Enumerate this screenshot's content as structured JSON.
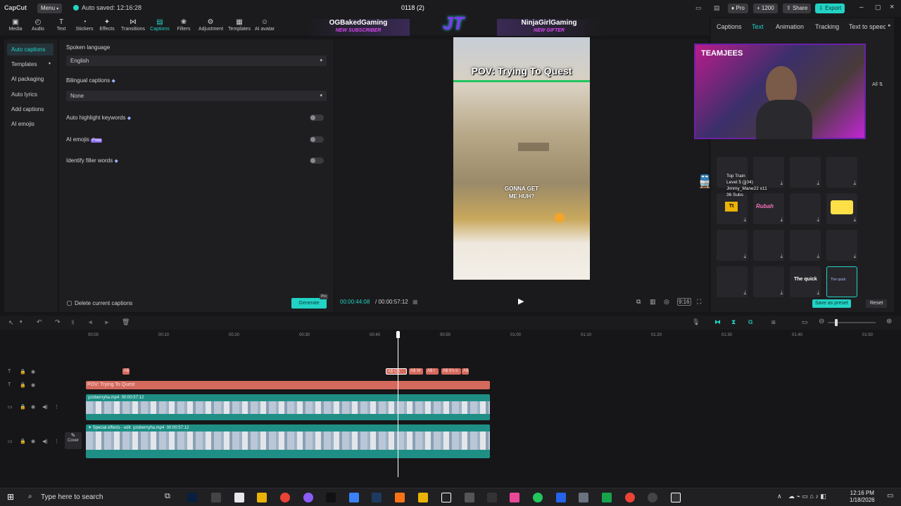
{
  "titlebar": {
    "app_name": "CapCut",
    "menu_label": "Menu",
    "autosave": "Auto saved: 12:16:28",
    "project_name": "0118 (2)",
    "pro_label": "Pro",
    "credits": "1200",
    "share_label": "Share",
    "export_label": "Export"
  },
  "toolbar": {
    "items": [
      {
        "label": "Media",
        "icon": "media-icon"
      },
      {
        "label": "Audio",
        "icon": "audio-icon"
      },
      {
        "label": "Text",
        "icon": "text-icon"
      },
      {
        "label": "Stickers",
        "icon": "stickers-icon"
      },
      {
        "label": "Effects",
        "icon": "effects-icon"
      },
      {
        "label": "Transitions",
        "icon": "transitions-icon"
      },
      {
        "label": "Captions",
        "icon": "captions-icon"
      },
      {
        "label": "Filters",
        "icon": "filters-icon"
      },
      {
        "label": "Adjustment",
        "icon": "adjustment-icon"
      },
      {
        "label": "Templates",
        "icon": "templates-icon"
      },
      {
        "label": "AI avatar",
        "icon": "ai-avatar-icon"
      }
    ]
  },
  "overlay": {
    "subscriber_name": "OGBakedGaming",
    "subscriber_tag": "NEW SUBSCRIBER",
    "logo": "JT",
    "gifter_name": "NinjaGirlGaming",
    "gifter_tag": "NEW GIFTER",
    "team_label": "TEAMJEES"
  },
  "leftnav": {
    "items": [
      "Auto captions",
      "Templates",
      "AI packaging",
      "Auto lyrics",
      "Add captions",
      "AI emojis"
    ]
  },
  "captions": {
    "spoken_language_label": "Spoken language",
    "spoken_language_value": "English",
    "bilingual_label": "Bilingual captions",
    "bilingual_value": "None",
    "highlight_label": "Auto highlight keywords",
    "emojis_label": "AI emojis",
    "emojis_badge": "Free",
    "filler_label": "Identify filler words",
    "delete_label": "Delete current captions",
    "generate_label": "Generate",
    "generate_badge": "Pro"
  },
  "player": {
    "title_text": "POV: Trying To Quest",
    "caption_text": "GONNA GET ME HUH?",
    "time_current": "00:00:44:08",
    "time_total": "00:00:57:12"
  },
  "rightpanel": {
    "tabs": [
      "Captions",
      "Text",
      "Animation",
      "Tracking",
      "Text to speech"
    ],
    "all_label": "All",
    "save_preset_label": "Save as preset",
    "reset_label": "Reset",
    "train_lines": [
      "Top Train",
      "Level 5 (104)",
      "Jimmy_Mane22 x11",
      "36 Subs"
    ],
    "tile_labels": [
      "Rubah",
      "The quick",
      "The quick"
    ]
  },
  "timeline": {
    "ticks": [
      "00:00",
      "00:10",
      "00:20",
      "00:30",
      "00:40",
      "00:50",
      "01:00",
      "01:10",
      "01:20",
      "01:30",
      "01:40",
      "01:50"
    ],
    "text_clip": "POV: Trying To Quest",
    "caption_clips": [
      "A$",
      "A$ Oh",
      "A$ W",
      "A$ I",
      "A$ It's o",
      "A$"
    ],
    "video1_name": "yzobernyha.mp4",
    "video1_duration": "00:00:57:12",
    "video2_effect": "Special effects - edit",
    "video2_name": "yzobernyha.mp4",
    "video2_duration": "00:00:57:12",
    "cover_label": "Cover"
  },
  "taskbar": {
    "search_placeholder": "Type here to search",
    "time": "12:16 PM",
    "date": "1/18/2026"
  }
}
